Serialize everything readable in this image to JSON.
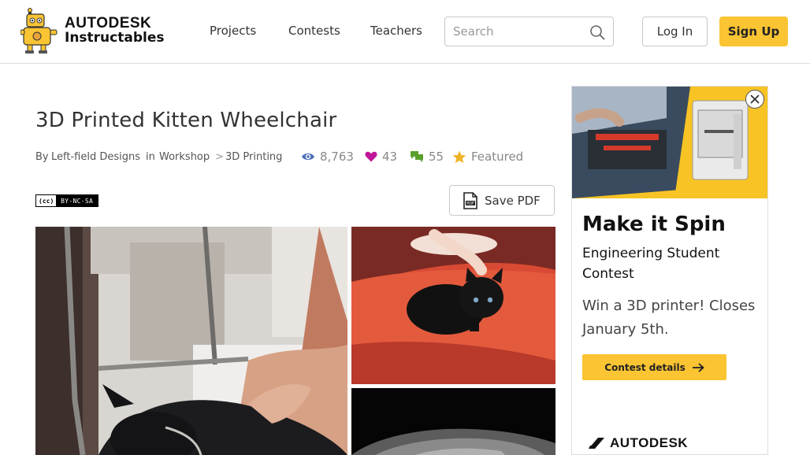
{
  "header": {
    "logo": {
      "brand": "AUTODESK",
      "product": "Instructables"
    },
    "nav": [
      "Projects",
      "Contests",
      "Teachers"
    ],
    "search": {
      "placeholder": "Search",
      "value": ""
    },
    "login_label": "Log In",
    "signup_label": "Sign Up"
  },
  "article": {
    "title": "3D Printed Kitten Wheelchair",
    "by_label": "By",
    "author": "Left-field Designs",
    "in_label": "in",
    "category": "Workshop",
    "separator": ">",
    "subcategory": "3D Printing",
    "views": "8,763",
    "favorites": "43",
    "comments": "55",
    "featured_label": "Featured",
    "license": {
      "left": "(cc)",
      "right": "BY-NC-SA"
    },
    "save_pdf_label": "Save PDF"
  },
  "ad": {
    "headline": "Make it Spin",
    "subheadline": "Engineering Student Contest",
    "body": "Win a 3D printer! Closes January 5th.",
    "button_label": "Contest details",
    "brand": "AUTODESK"
  },
  "colors": {
    "accent_yellow": "#fac432",
    "views_icon": "#4a6fb5",
    "heart_icon": "#c0179a",
    "comment_icon": "#5aa02c",
    "star_icon": "#f0b429"
  },
  "icons": {
    "search": "search-icon",
    "views": "eye-icon",
    "favorites": "heart-icon",
    "comments": "comment-icon",
    "featured": "star-icon",
    "pdf": "pdf-icon",
    "close": "close-icon",
    "arrow": "arrow-right-icon"
  }
}
